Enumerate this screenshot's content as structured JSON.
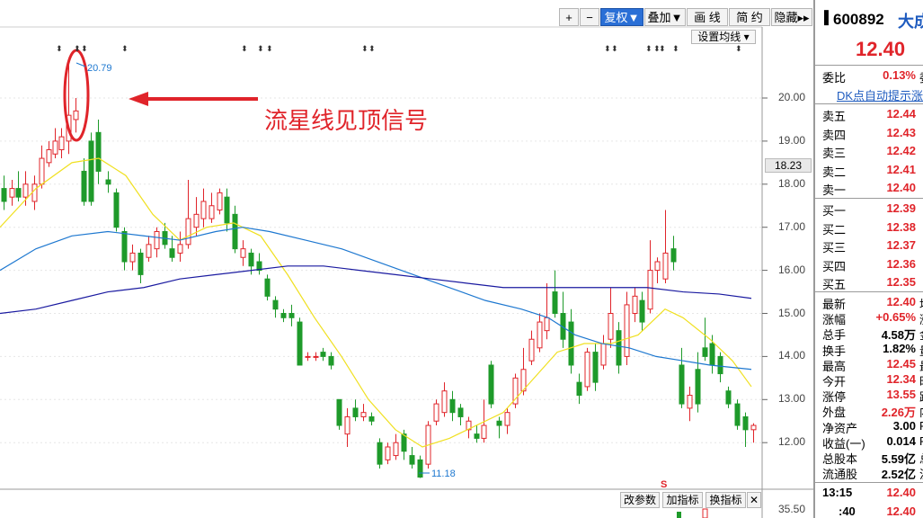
{
  "toolbar": {
    "plus": "+",
    "minus": "−",
    "fuquan": "复权",
    "fuquan_arrow": "▼",
    "diejia": "叠加",
    "diejia_arrow": "▼",
    "huaxian": "画 线",
    "jianyue": "简 约",
    "yincang": "隐藏",
    "yincang_arrow": "▸▸"
  },
  "ma_setting": "设置均线",
  "annotation": "流星线见顶信号",
  "high_label": "20.79",
  "low_label": "11.18",
  "current_price_tag": "18.23",
  "price_axis": [
    "20.00",
    "19.00",
    "18.00",
    "17.00",
    "16.00",
    "15.00",
    "14.00",
    "13.00",
    "12.00"
  ],
  "bottom_price": "35.50",
  "bottom_buttons": [
    "改参数",
    "加指标",
    "换指标",
    "✕"
  ],
  "s_marker": "S",
  "right_panel": {
    "code": "600892",
    "name": "大成",
    "price": "12.40",
    "weibi_label": "委比",
    "weibi_value": "0.13%",
    "weibi_extra": "委",
    "dk_link": "DK点自动提示涨",
    "sell": [
      {
        "label": "卖五",
        "value": "12.44"
      },
      {
        "label": "卖四",
        "value": "12.43"
      },
      {
        "label": "卖三",
        "value": "12.42"
      },
      {
        "label": "卖二",
        "value": "12.41"
      },
      {
        "label": "卖一",
        "value": "12.40"
      }
    ],
    "buy": [
      {
        "label": "买一",
        "value": "12.39"
      },
      {
        "label": "买二",
        "value": "12.38"
      },
      {
        "label": "买三",
        "value": "12.37"
      },
      {
        "label": "买四",
        "value": "12.36"
      },
      {
        "label": "买五",
        "value": "12.35"
      }
    ],
    "stats": [
      {
        "label": "最新",
        "value": "12.40",
        "extra": "均",
        "color": "red"
      },
      {
        "label": "涨幅",
        "value": "+0.65%",
        "extra": "涨",
        "color": "red"
      },
      {
        "label": "总手",
        "value": "4.58万",
        "extra": "金",
        "color": "black"
      },
      {
        "label": "换手",
        "value": "1.82%",
        "extra": "量",
        "color": "black"
      },
      {
        "label": "最高",
        "value": "12.45",
        "extra": "最",
        "color": "red"
      },
      {
        "label": "今开",
        "value": "12.34",
        "extra": "昨",
        "color": "red"
      },
      {
        "label": "涨停",
        "value": "13.55",
        "extra": "跌",
        "color": "red"
      },
      {
        "label": "外盘",
        "value": "2.26万",
        "extra": "内",
        "color": "red"
      },
      {
        "label": "净资产",
        "value": "3.00",
        "extra": "RO",
        "color": "black"
      },
      {
        "label": "收益(一)",
        "value": "0.014",
        "extra": "PE",
        "color": "black"
      },
      {
        "label": "总股本",
        "value": "5.59亿",
        "extra": "总",
        "color": "black"
      },
      {
        "label": "流通股",
        "value": "2.52亿",
        "extra": "流",
        "color": "black"
      }
    ],
    "ticks": [
      {
        "time": "13:15",
        "price": "12.40"
      },
      {
        "time": ":40",
        "price": "12.40"
      }
    ]
  },
  "colors": {
    "up": "#e0242a",
    "down": "#1e9a2a",
    "ma5": "#f0e020",
    "ma20": "#1e78d0",
    "ma60": "#1a1aa0",
    "accent": "#2a6fd6"
  }
}
